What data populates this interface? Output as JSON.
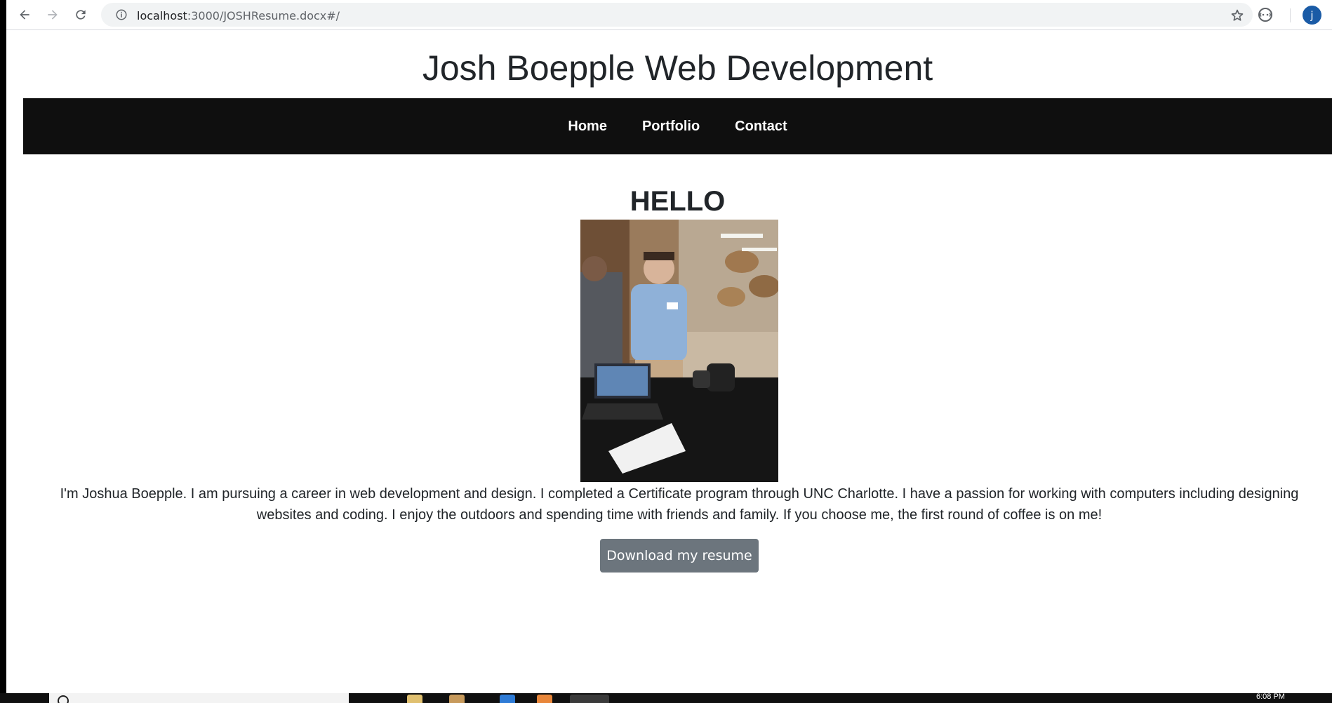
{
  "browser": {
    "url_host": "localhost",
    "url_path": ":3000/JOSHResume.docx#/",
    "profile_initial": "j"
  },
  "site": {
    "title": "Josh Boepple Web Development",
    "nav": [
      {
        "label": "Home"
      },
      {
        "label": "Portfolio"
      },
      {
        "label": "Contact"
      }
    ]
  },
  "main": {
    "heading": "HELLO",
    "bio": "I'm Joshua Boepple. I am pursuing a career in web development and design. I completed a Certificate program through UNC Charlotte. I have a passion for working with computers including designing websites and coding. I enjoy the outdoors and spending time with friends and family. If you choose me, the first round of coffee is on me!",
    "resume_button": "Download my resume"
  },
  "taskbar": {
    "time": "6:08 PM"
  },
  "colors": {
    "navbar_bg": "#0f0f0f",
    "button_bg": "#6c757d",
    "avatar_bg": "#1a5ba6"
  }
}
